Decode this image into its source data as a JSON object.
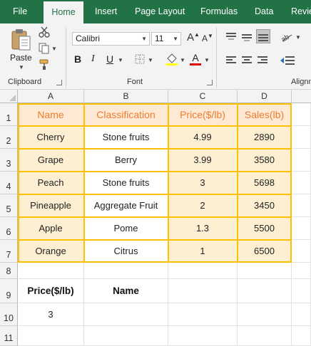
{
  "ribbon": {
    "tabs": [
      "File",
      "Home",
      "Insert",
      "Page Layout",
      "Formulas",
      "Data",
      "Revie"
    ],
    "active_tab": "Home",
    "clipboard": {
      "paste_label": "Paste",
      "group_label": "Clipboard"
    },
    "font": {
      "font_name": "Calibri",
      "font_size": "11",
      "group_label": "Font"
    },
    "alignment": {
      "group_label": "Alignm"
    }
  },
  "sheet": {
    "columns": [
      "A",
      "B",
      "C",
      "D"
    ],
    "rows": [
      "1",
      "2",
      "3",
      "4",
      "5",
      "6",
      "7",
      "8",
      "9",
      "10",
      "11"
    ],
    "table": {
      "headers": [
        "Name",
        "Classification",
        "Price($/lb)",
        "Sales(lb)"
      ],
      "rows": [
        [
          "Cherry",
          "Stone fruits",
          "4.99",
          "2890"
        ],
        [
          "Grape",
          "Berry",
          "3.99",
          "3580"
        ],
        [
          "Peach",
          "Stone fruits",
          "3",
          "5698"
        ],
        [
          "Pineapple",
          "Aggregate Fruit",
          "2",
          "3450"
        ],
        [
          "Apple",
          "Pome",
          "1.3",
          "5500"
        ],
        [
          "Orange",
          "Citrus",
          "1",
          "6500"
        ]
      ]
    },
    "criteria": {
      "header_a": "Price($/lb)",
      "header_b": "Name",
      "value_a": "3"
    }
  },
  "colors": {
    "accent": "#217346",
    "header_fill": "#fde9d4",
    "header_text": "#ed7d31",
    "data_fill": "#fdf0d2",
    "border": "#ffc000"
  },
  "icons": [
    "paste-icon",
    "cut-icon",
    "copy-icon",
    "format-painter-icon",
    "bold-icon",
    "italic-icon",
    "underline-icon",
    "borders-icon",
    "fill-color-icon",
    "font-color-icon",
    "increase-font-icon",
    "decrease-font-icon",
    "align-top-icon",
    "align-middle-icon",
    "align-bottom-icon",
    "orientation-icon",
    "align-left-icon",
    "align-center-icon",
    "align-right-icon",
    "decrease-indent-icon"
  ]
}
